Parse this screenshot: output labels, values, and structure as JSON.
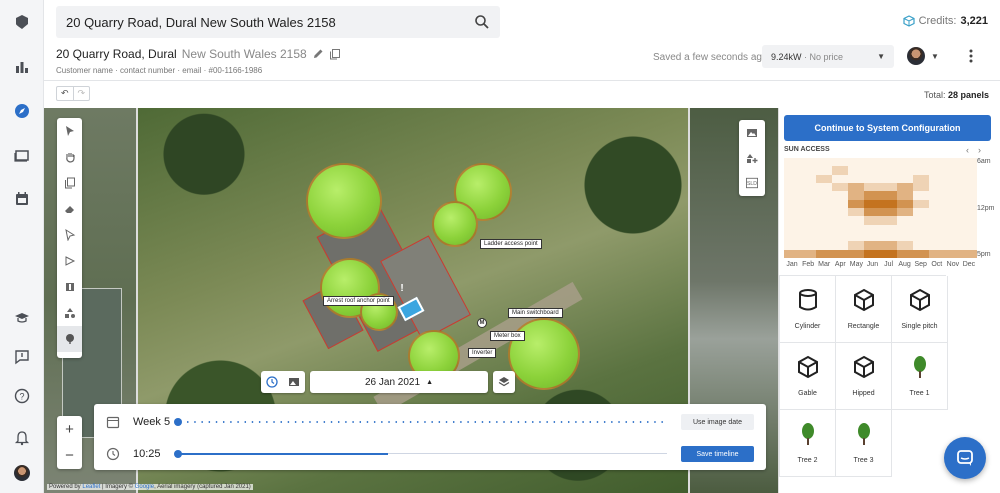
{
  "header": {
    "search_value": "20 Quarry Road, Dural New South Wales 2158",
    "credits_label": "Credits:",
    "credits_value": "3,221",
    "title_main": "20 Quarry Road, Dural",
    "title_rest": "New South Wales 2158",
    "subtitle": "Customer name · contact number · email · #00-1166-1986",
    "saved_status": "Saved a few seconds ago",
    "system_size": "9.24kW",
    "system_price": "· No price",
    "total_label": "Total:",
    "total_value": "28 panels"
  },
  "map": {
    "labels": {
      "ladder": "Ladder access point",
      "anchor": "Arrest roof anchor point",
      "switchboard": "Main switchboard",
      "meter": "Meter box",
      "inverter": "Inverter"
    },
    "markers": {
      "meter": "M",
      "hazard": "!"
    },
    "date": "26 Jan 2021",
    "attribution_prefix": "Powered by",
    "attribution_leaflet": "Leaflet",
    "attribution_mid": "| Imagery ©",
    "attribution_google": "Google",
    "attribution_suffix": ", Aerial imagery (captured Jan 2021)"
  },
  "timeline": {
    "week_label": "Week 5",
    "week_progress": 0.0,
    "time_label": "10:25",
    "time_progress": 0.43,
    "use_image_date": "Use image date",
    "save_timeline": "Save timeline"
  },
  "panel": {
    "cta": "Continue to System Configuration",
    "sun_access_title": "SUN ACCESS",
    "y_labels": [
      "6am",
      "12pm",
      "5pm"
    ],
    "months": [
      "Jan",
      "Feb",
      "Mar",
      "Apr",
      "May",
      "Jun",
      "Jul",
      "Aug",
      "Sep",
      "Oct",
      "Nov",
      "Dec"
    ],
    "objects": [
      {
        "label": "Cylinder",
        "icon": "cylinder-icon"
      },
      {
        "label": "Rectangle",
        "icon": "cube-icon"
      },
      {
        "label": "Single pitch",
        "icon": "cube-icon"
      },
      {
        "label": "Gable",
        "icon": "cube-icon"
      },
      {
        "label": "Hipped",
        "icon": "cube-icon"
      },
      {
        "label": "Tree 1",
        "icon": "tree-icon"
      },
      {
        "label": "Tree 2",
        "icon": "tree-icon"
      },
      {
        "label": "Tree 3",
        "icon": "tree-icon"
      }
    ]
  },
  "colors": {
    "accent": "#2c6fc8",
    "tree": "#8cd23a",
    "heat_low": "#fdf3e7",
    "heat_high": "#c4731f"
  }
}
